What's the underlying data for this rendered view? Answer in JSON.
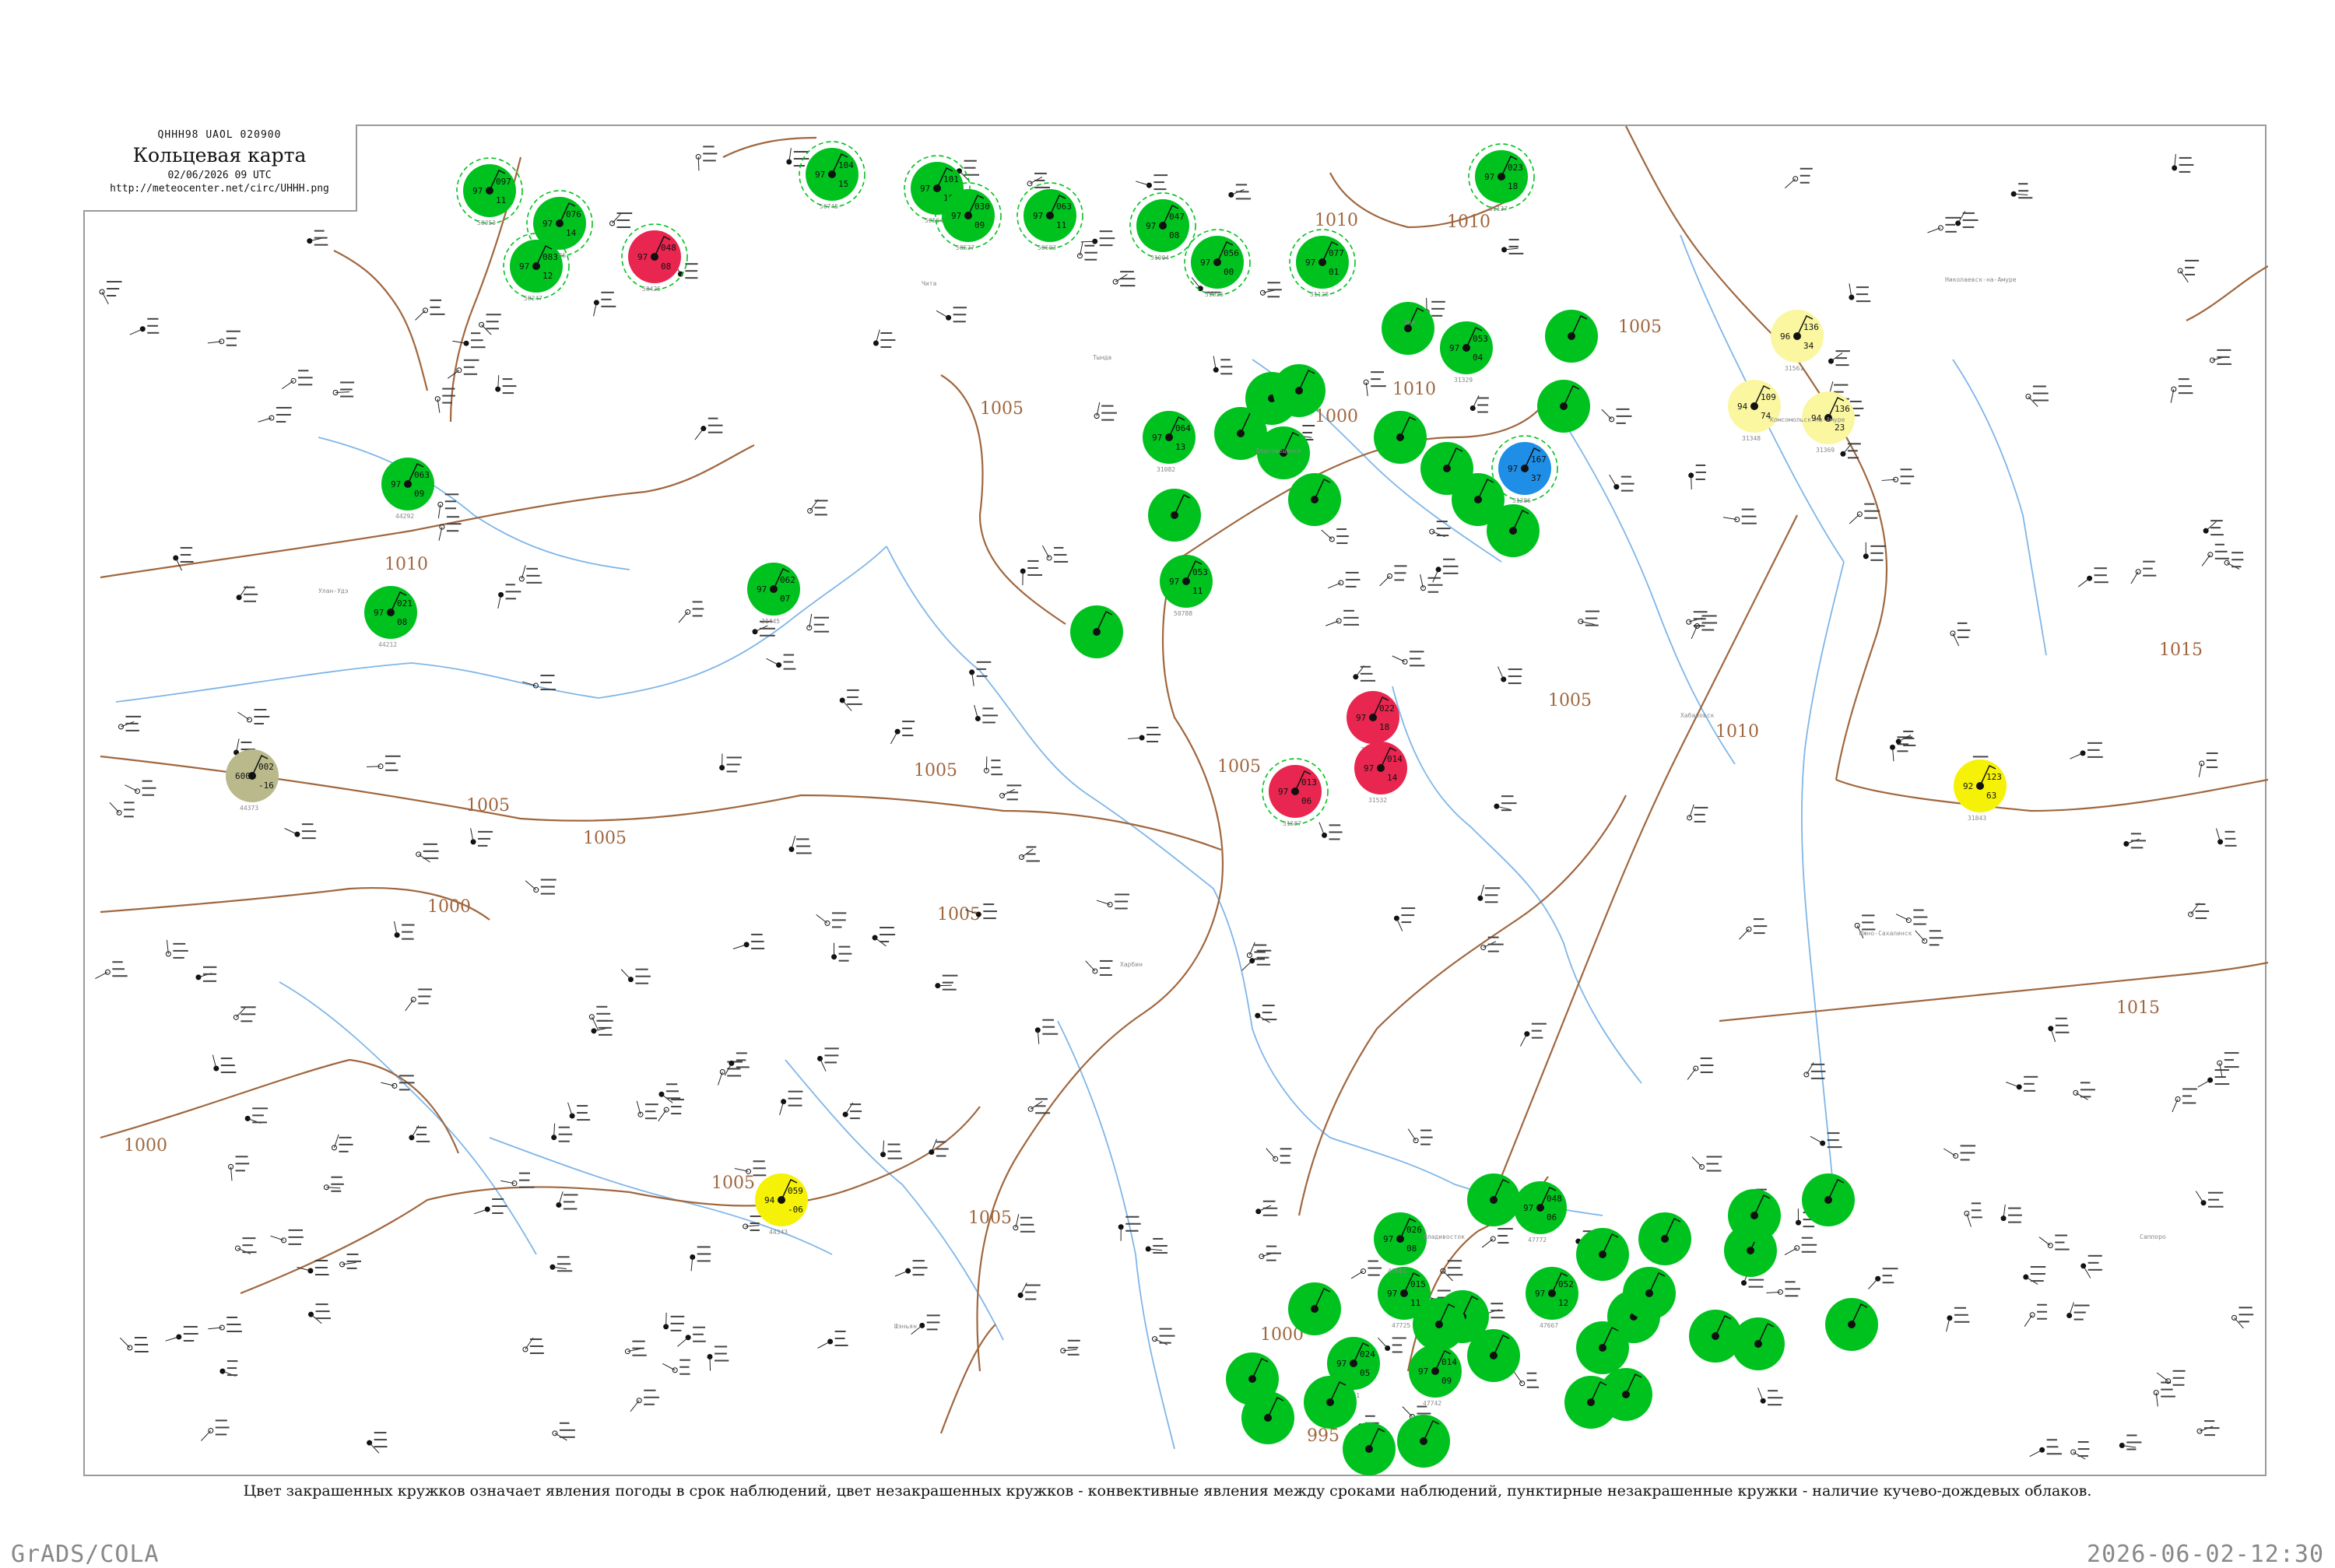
{
  "header": {
    "code": "QHHH98  UAOL  020900",
    "title": "Кольцевая карта",
    "datetime": "02/06/2026 09 UTC",
    "url": "http://meteocenter.net/circ/UHHH.png"
  },
  "caption": "Цвет закрашенных кружков означает явления погоды в срок наблюдений, цвет незакрашенных кружков - конвективные явления между сроками наблюдений, пунктирные незакрашенные кружки - наличие кучево-дождевых облаков.",
  "footer": {
    "left": "GrADS/COLA",
    "right": "2026-06-02-12:30"
  },
  "colors": {
    "green": "#00c21f",
    "red": "#e8264f",
    "blue": "#1e8ee6",
    "yellow": "#f5f207",
    "pale_yellow": "#faf7a0",
    "olive": "#b9b98c",
    "isobar": "#a0673f",
    "river": "#7fb6e8"
  },
  "isobar_labels": [
    "1010",
    "1005",
    "1000",
    "1005",
    "1010",
    "1005",
    "1000",
    "1005",
    "1010",
    "1005",
    "1005",
    "1015",
    "1015",
    "1010",
    "1005",
    "1000",
    "995",
    "1005",
    "1005",
    "1000",
    "1005",
    "1010",
    "1005"
  ],
  "stations": [
    {
      "id": "50353",
      "fill": "green",
      "ring": true,
      "top": "097",
      "mid": "97",
      "bot": "11"
    },
    {
      "id": "50136",
      "fill": "green",
      "ring": true,
      "top": "076",
      "mid": "97",
      "bot": "14"
    },
    {
      "id": "50247",
      "fill": "green",
      "ring": true,
      "top": "083",
      "mid": "97",
      "bot": "12"
    },
    {
      "id": "50425",
      "fill": "red",
      "ring": true,
      "top": "048",
      "mid": "97",
      "bot": "08"
    },
    {
      "id": "50745",
      "fill": "green",
      "ring": true,
      "top": "104",
      "mid": "97",
      "bot": "15"
    },
    {
      "id": "50564",
      "fill": "green",
      "ring": true,
      "top": "101",
      "mid": "97",
      "bot": "16"
    },
    {
      "id": "50527",
      "fill": "green",
      "ring": true,
      "top": "030",
      "mid": "97",
      "bot": "09"
    },
    {
      "id": "50603",
      "fill": "green",
      "ring": true,
      "top": "063",
      "mid": "97",
      "bot": "11"
    },
    {
      "id": "31004",
      "fill": "green",
      "ring": true,
      "top": "047",
      "mid": "97",
      "bot": "08"
    },
    {
      "id": "31025",
      "fill": "green",
      "ring": true,
      "top": "056",
      "mid": "97",
      "bot": "00"
    },
    {
      "id": "31082",
      "fill": "green",
      "ring": false,
      "top": "064",
      "mid": "97",
      "bot": "13"
    },
    {
      "id": "31128",
      "fill": "green",
      "ring": true,
      "top": "077",
      "mid": "97",
      "bot": "01"
    },
    {
      "id": "31137",
      "fill": "green",
      "ring": true,
      "top": "023",
      "mid": "97",
      "bot": "18"
    },
    {
      "id": "31329",
      "fill": "green",
      "ring": false,
      "top": "053",
      "mid": "97",
      "bot": "04"
    },
    {
      "id": "31386",
      "fill": "blue",
      "ring": true,
      "top": "167",
      "mid": "97",
      "bot": "37"
    },
    {
      "id": "31510",
      "fill": "red",
      "ring": false,
      "top": "022",
      "mid": "97",
      "bot": "18"
    },
    {
      "id": "31532",
      "fill": "red",
      "ring": false,
      "top": "014",
      "mid": "97",
      "bot": "14"
    },
    {
      "id": "31587",
      "fill": "red",
      "ring": true,
      "top": "013",
      "mid": "97",
      "bot": "06"
    },
    {
      "id": "44292",
      "fill": "green",
      "ring": false,
      "top": "063",
      "mid": "97",
      "bot": "09"
    },
    {
      "id": "44373",
      "fill": "olive",
      "ring": false,
      "top": "002",
      "mid": "600",
      "bot": "-16"
    },
    {
      "id": "44212",
      "fill": "green",
      "ring": false,
      "top": "021",
      "mid": "97",
      "bot": "08"
    },
    {
      "id": "44343",
      "fill": "yellow",
      "ring": false,
      "top": "059",
      "mid": "94",
      "bot": "-06"
    },
    {
      "id": "31445",
      "fill": "green",
      "ring": false,
      "top": "062",
      "mid": "97",
      "bot": "07"
    },
    {
      "id": "50788",
      "fill": "green",
      "ring": false,
      "top": "053",
      "mid": "97",
      "bot": "11"
    },
    {
      "id": "31843",
      "fill": "yellow",
      "ring": false,
      "top": "123",
      "mid": "92",
      "bot": "63"
    },
    {
      "id": "31561",
      "fill": "pale_yellow",
      "ring": false,
      "top": "136",
      "mid": "96",
      "bot": "34"
    },
    {
      "id": "31348",
      "fill": "pale_yellow",
      "ring": false,
      "top": "109",
      "mid": "94",
      "bot": "74"
    },
    {
      "id": "31369",
      "fill": "pale_yellow",
      "ring": false,
      "top": "136",
      "mid": "94",
      "bot": "23"
    },
    {
      "id": "47725",
      "fill": "green",
      "ring": false,
      "top": "015",
      "mid": "97",
      "bot": "11"
    },
    {
      "id": "47742",
      "fill": "green",
      "ring": false,
      "top": "014",
      "mid": "97",
      "bot": "09"
    },
    {
      "id": "47741",
      "fill": "green",
      "ring": false,
      "top": "024",
      "mid": "97",
      "bot": "05"
    },
    {
      "id": "47661",
      "fill": "green",
      "ring": false,
      "top": "026",
      "mid": "97",
      "bot": "08"
    },
    {
      "id": "47667",
      "fill": "green",
      "ring": false,
      "top": "052",
      "mid": "97",
      "bot": "12"
    },
    {
      "id": "47772",
      "fill": "green",
      "ring": false,
      "top": "048",
      "mid": "97",
      "bot": "06"
    }
  ],
  "place_labels": [
    "Кольцевая карта",
    "Зея",
    "Тында",
    "Благовещенск",
    "Хабаровск",
    "Комсомольск-на-Амуре",
    "Николаевск-на-Амуре",
    "Чита",
    "Улан-Удэ",
    "Шэньян",
    "Харбин",
    "Владивосток",
    "Южно-Сахалинск",
    "Саппоро"
  ]
}
